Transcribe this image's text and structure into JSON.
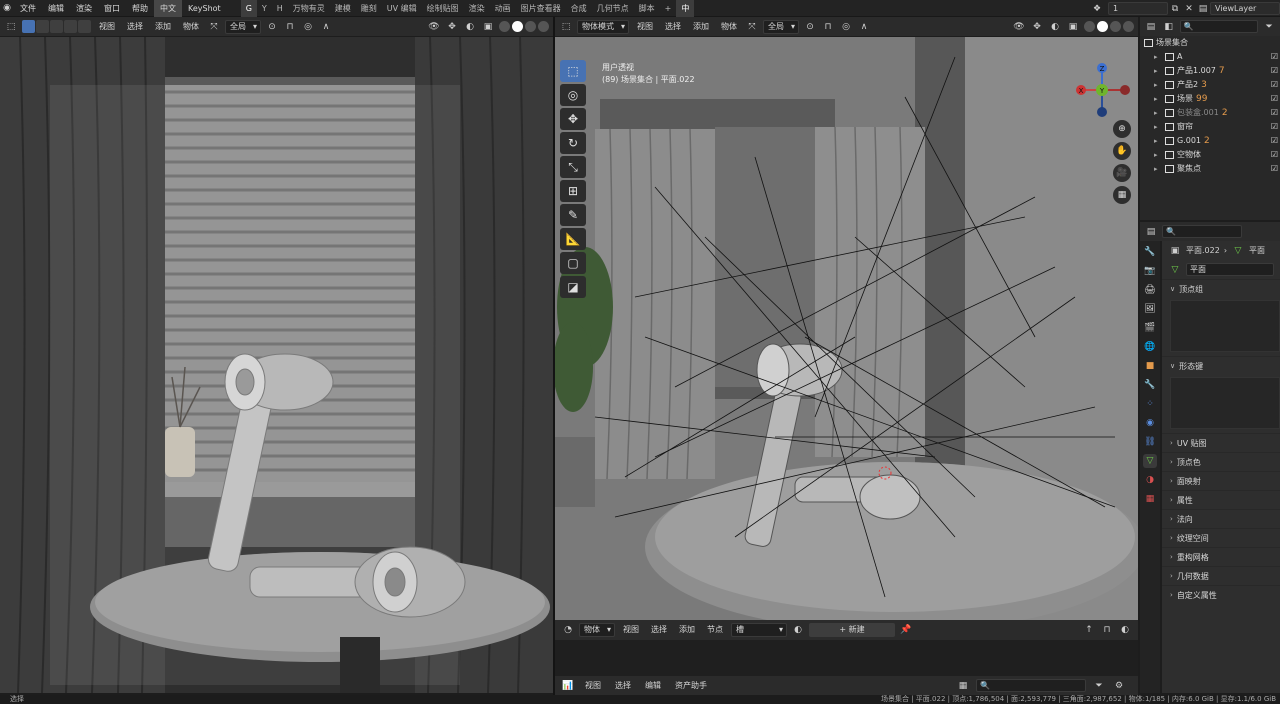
{
  "topbar": {
    "menus": [
      "文件",
      "编辑",
      "渲染",
      "窗口",
      "帮助"
    ],
    "lang": "中文",
    "keyshot": "KeyShot",
    "workspaces": [
      "G",
      "Y",
      "H",
      "万物有灵",
      "建模",
      "雕刻",
      "UV 编辑",
      "绘制贴图",
      "渲染",
      "动画",
      "图片查看器",
      "合成",
      "几何节点",
      "脚本"
    ],
    "active_workspace": "G",
    "add_tab": "+",
    "extra_tab": "中",
    "scene_value": "1",
    "view_layer": "ViewLayer"
  },
  "left_header": {
    "buttons": [
      "视图",
      "选择",
      "添加",
      "物体"
    ],
    "transform": "全局",
    "options": "选项"
  },
  "right_header": {
    "mode": "物体模式",
    "buttons": [
      "视图",
      "选择",
      "添加",
      "物体"
    ],
    "transform": "全局",
    "options": "选项"
  },
  "viewport_info": {
    "line1": "用户透视",
    "line2": "(89) 场景集合 | 平面.022"
  },
  "gizmo": {
    "z": "Z",
    "y": "Y",
    "x": "X"
  },
  "outliner": {
    "root": "场景集合",
    "items": [
      {
        "name": "A",
        "dim": false,
        "badge": ""
      },
      {
        "name": "产品1.007",
        "dim": false,
        "badge": "7"
      },
      {
        "name": "产品2",
        "dim": false,
        "badge": "3"
      },
      {
        "name": "场景",
        "dim": false,
        "badge": "99"
      },
      {
        "name": "包装盒.001",
        "dim": true,
        "badge": "2"
      },
      {
        "name": "窗帘",
        "dim": false,
        "badge": ""
      },
      {
        "name": "G.001",
        "dim": false,
        "badge": "2"
      },
      {
        "name": "空物体",
        "dim": false,
        "badge": ""
      },
      {
        "name": "聚焦点",
        "dim": false,
        "badge": ""
      }
    ]
  },
  "properties": {
    "object": "平面.022",
    "mesh": "平面",
    "mesh_field": "平面",
    "panels": [
      "顶点组",
      "形态键",
      "UV 贴图",
      "顶点色",
      "面映射",
      "属性",
      "法向",
      "纹理空间",
      "重构网格",
      "几何数据",
      "自定义属性"
    ]
  },
  "shader_header": {
    "type": "物体",
    "buttons": [
      "视图",
      "选择",
      "添加",
      "节点"
    ],
    "slot": "槽",
    "new_btn": "新建"
  },
  "asset_header": {
    "buttons": [
      "视图",
      "选择",
      "编辑",
      "资产助手"
    ]
  },
  "status": {
    "left": "选择",
    "right": "场景集合 | 平面.022 | 顶点:1,786,504 | 面:2,593,779 | 三角面:2,987,652 | 物体:1/185 | 内存:6.0 GiB | 显存:1.1/6.0 GiB"
  }
}
